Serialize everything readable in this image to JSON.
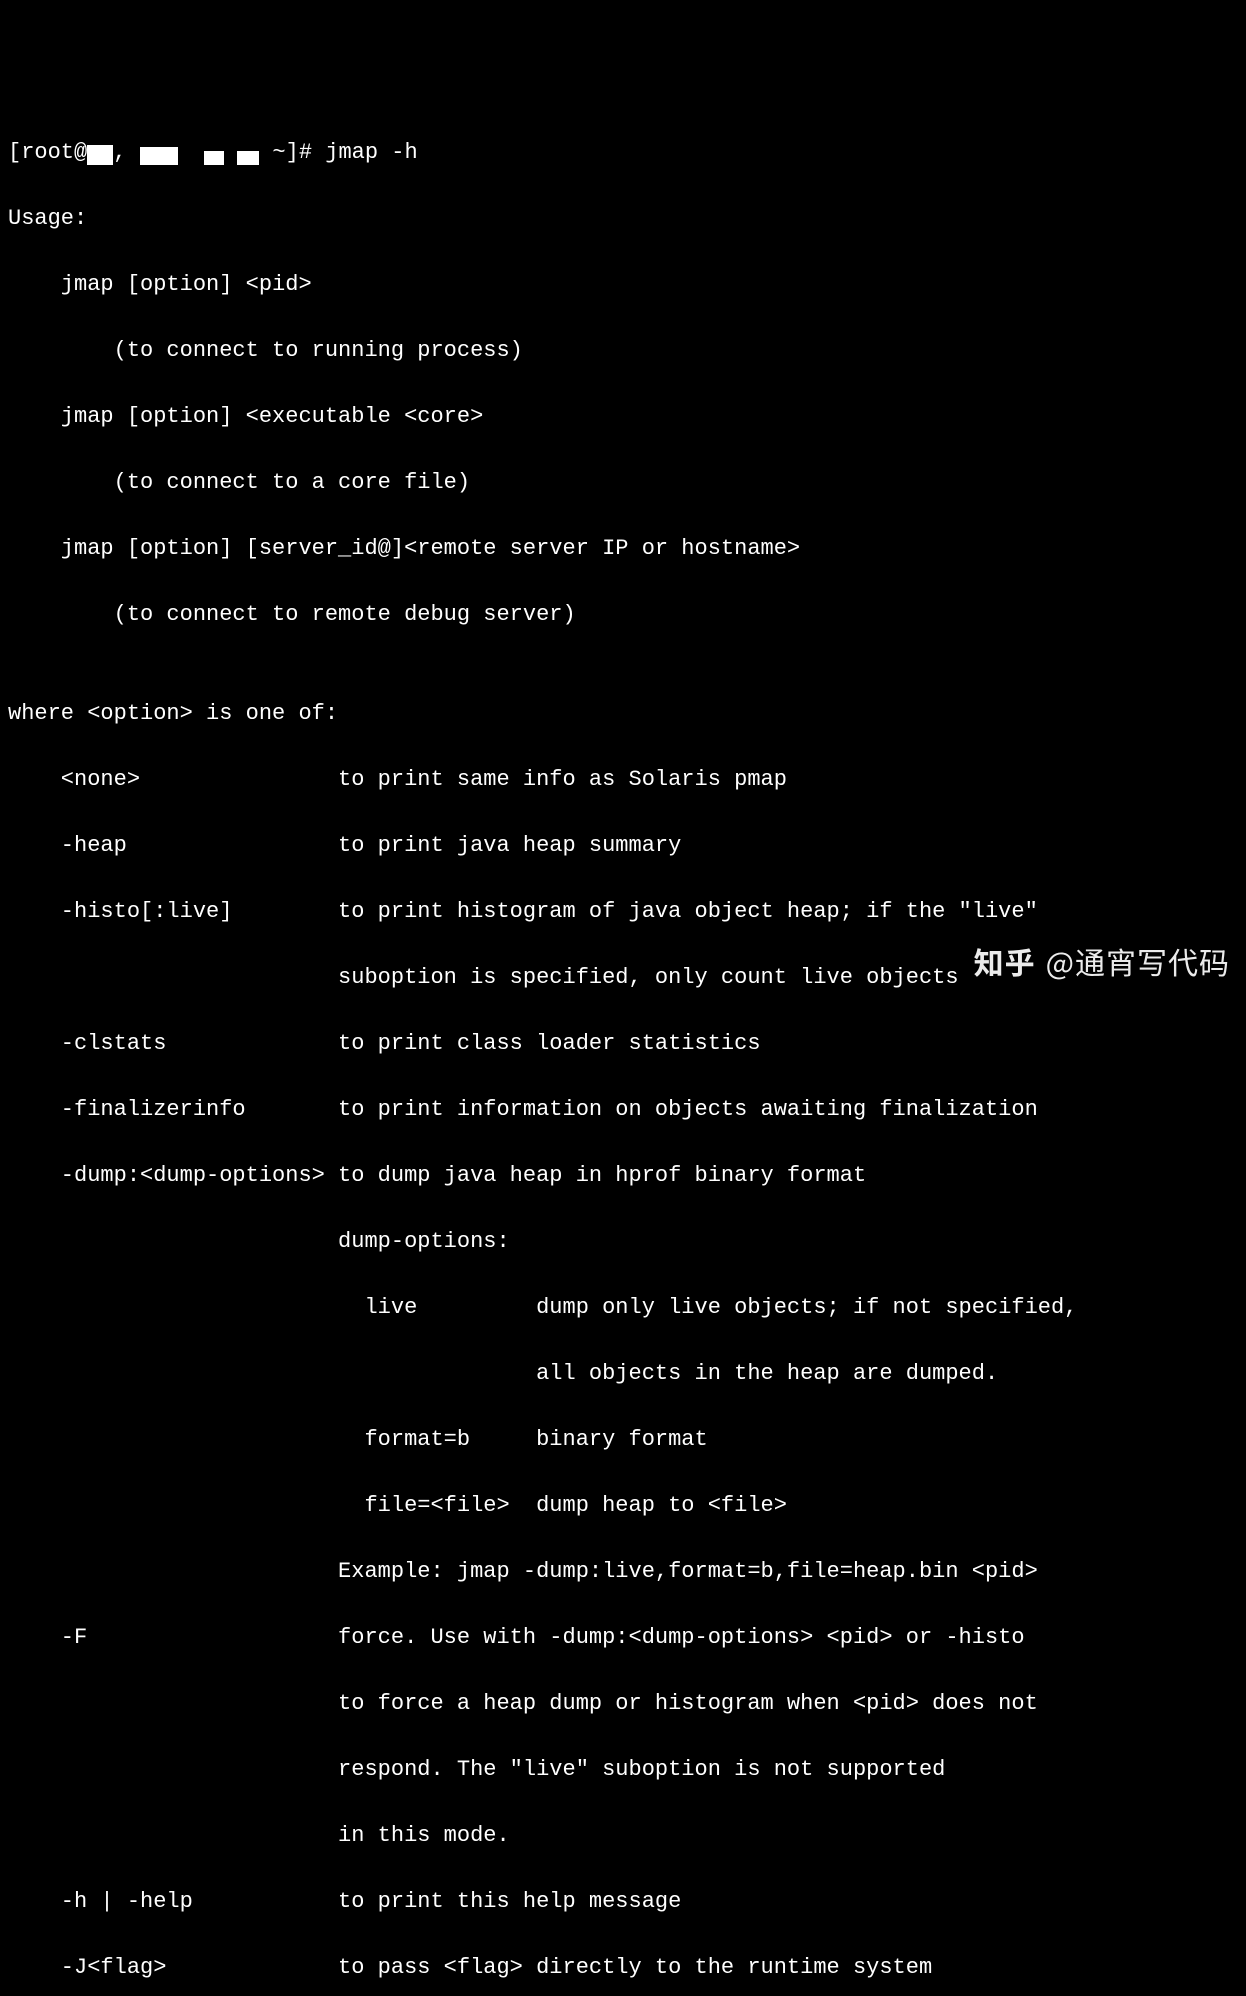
{
  "prompt": {
    "prefix": "[root@",
    "mid1": ",",
    "mid2": " ",
    "mid3": " ",
    "suffix_before_cmd": " ~]# ",
    "command": "jmap -h"
  },
  "lines": {
    "l01": "Usage:",
    "l02": "    jmap [option] <pid>",
    "l03": "        (to connect to running process)",
    "l04": "    jmap [option] <executable <core>",
    "l05": "        (to connect to a core file)",
    "l06": "    jmap [option] [server_id@]<remote server IP or hostname>",
    "l07": "        (to connect to remote debug server)",
    "l08": "",
    "l09": "where <option> is one of:",
    "l10": "    <none>               to print same info as Solaris pmap",
    "l11": "    -heap                to print java heap summary",
    "l12": "    -histo[:live]        to print histogram of java object heap; if the \"live\"",
    "l13": "                         suboption is specified, only count live objects",
    "l14": "    -clstats             to print class loader statistics",
    "l15": "    -finalizerinfo       to print information on objects awaiting finalization",
    "l16": "    -dump:<dump-options> to dump java heap in hprof binary format",
    "l17": "                         dump-options:",
    "l18": "                           live         dump only live objects; if not specified,",
    "l19": "                                        all objects in the heap are dumped.",
    "l20": "                           format=b     binary format",
    "l21": "                           file=<file>  dump heap to <file>",
    "l22": "                         Example: jmap -dump:live,format=b,file=heap.bin <pid>",
    "l23": "    -F                   force. Use with -dump:<dump-options> <pid> or -histo",
    "l24": "                         to force a heap dump or histogram when <pid> does not",
    "l25": "                         respond. The \"live\" suboption is not supported",
    "l26": "                         in this mode.",
    "l27": "    -h | -help           to print this help message",
    "l28": "    -J<flag>             to pass <flag> directly to the runtime system"
  },
  "watermark": {
    "logo": "知乎",
    "text": "@通宵写代码"
  }
}
